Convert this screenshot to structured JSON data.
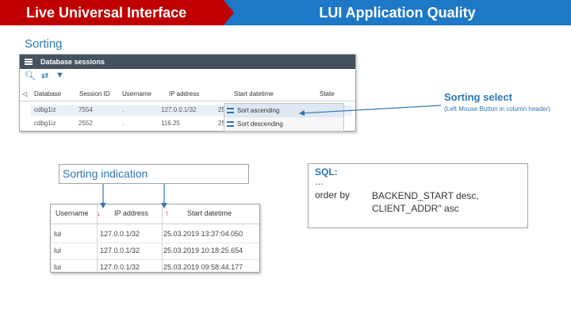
{
  "header": {
    "left_title": "Live Universal Interface",
    "right_title": "LUI Application Quality"
  },
  "section_title": "Sorting",
  "db_sessions": {
    "title": "Database sessions",
    "columns": [
      "Database",
      "Session ID",
      "Username",
      "IP address",
      "Start datetime",
      "State"
    ],
    "rows": [
      [
        "cdbg1iz",
        "7554",
        ".",
        "127.0.0.1/32",
        "25"
      ],
      [
        "cdbg1iz",
        "2552",
        ".",
        "116.25",
        "25"
      ]
    ],
    "menu": {
      "sort_ascending": "Sort ascending",
      "sort_descending": "Sort descending"
    }
  },
  "sorting_select": {
    "title": "Sorting select",
    "note": "(Left Mouse Button in column header)"
  },
  "sorting_indication": {
    "label": "Sorting indication"
  },
  "sql": {
    "title": "SQL:",
    "ellipsis": "…",
    "order_by": "order by",
    "value": "BACKEND_START desc, CLIENT_ADDR\" asc"
  },
  "result_table": {
    "columns": [
      "Username",
      "IP address",
      "Start datetime"
    ],
    "rows": [
      [
        "lui",
        "127.0.0.1/32",
        "25.03.2019 13:37:04.050"
      ],
      [
        "lui",
        "127.0.0.1/32",
        "25.03.2019 10:18:25.654"
      ],
      [
        "lui",
        "127.0.0.1/32",
        "25.03.2019 09:58:44.177"
      ]
    ]
  },
  "colors": {
    "header_red": "#c00000",
    "header_blue": "#1e78c8",
    "accent_blue": "#2e75b6"
  }
}
